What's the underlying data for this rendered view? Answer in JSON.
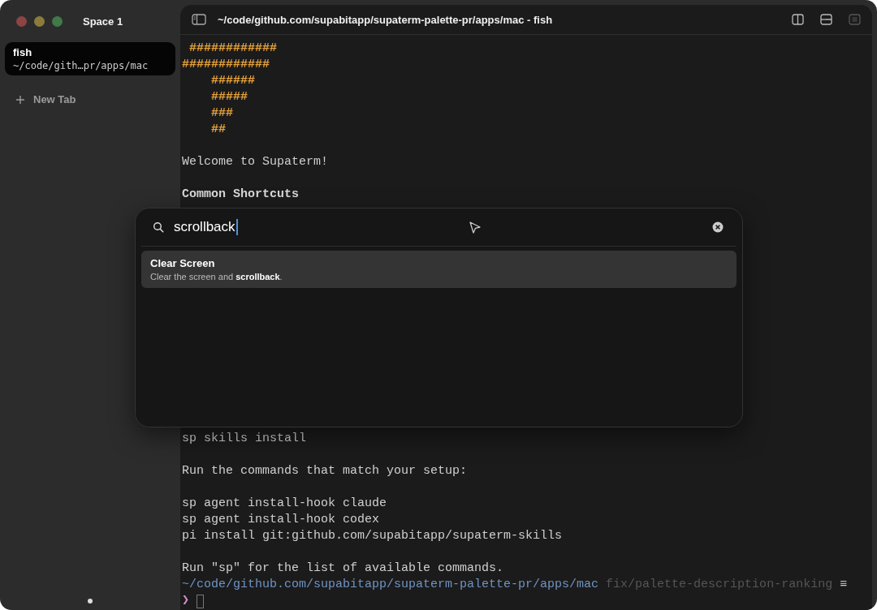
{
  "sidebar": {
    "space_title": "Space 1",
    "tabs": [
      {
        "title": "fish",
        "subtitle": "~/code/gith…pr/apps/mac",
        "selected": true
      }
    ],
    "new_tab": "New Tab"
  },
  "terminal": {
    "title": "~/code/github.com/supabitapp/supaterm-palette-pr/apps/mac - fish",
    "header_buttons": [
      {
        "kind": "split-vertical",
        "disabled": false
      },
      {
        "kind": "split-horizontal",
        "disabled": false
      },
      {
        "kind": "panel",
        "disabled": true
      }
    ],
    "top_blocks": [
      [
        {
          "kind": "banner",
          "text": " ############"
        },
        {
          "kind": "banner",
          "text": "############"
        },
        {
          "kind": "banner",
          "text": "    ######"
        },
        {
          "kind": "banner",
          "text": "    #####"
        },
        {
          "kind": "banner",
          "text": "    ###"
        },
        {
          "kind": "banner",
          "text": "    ##"
        }
      ],
      [
        {
          "kind": "text",
          "text": "Welcome to Supaterm!"
        }
      ],
      [
        {
          "kind": "heading",
          "text": "Common Shortcuts"
        }
      ]
    ],
    "bottom_blocks": [
      [
        {
          "kind": "text",
          "text": "sp skills install"
        }
      ],
      [
        {
          "kind": "text",
          "text": "Run the commands that match your setup:"
        }
      ],
      [
        {
          "kind": "text",
          "text": "sp agent install-hook claude"
        },
        {
          "kind": "text",
          "text": "sp agent install-hook codex"
        },
        {
          "kind": "text",
          "text": "pi install git:github.com/supabitapp/supaterm-skills"
        }
      ],
      [
        {
          "kind": "text",
          "text": "Run \"sp\" for the list of available commands."
        }
      ]
    ],
    "prompt": {
      "path": "~/code/github.com/supabitapp/supaterm-palette-pr/apps/mac",
      "branch": "fix/palette-description-ranking",
      "status": "≡",
      "symbol": "❯"
    }
  },
  "palette": {
    "query": "scrollback",
    "results": [
      {
        "title": "Clear Screen",
        "description": "Clear the screen and **scrollback**.",
        "selected": true
      }
    ]
  }
}
